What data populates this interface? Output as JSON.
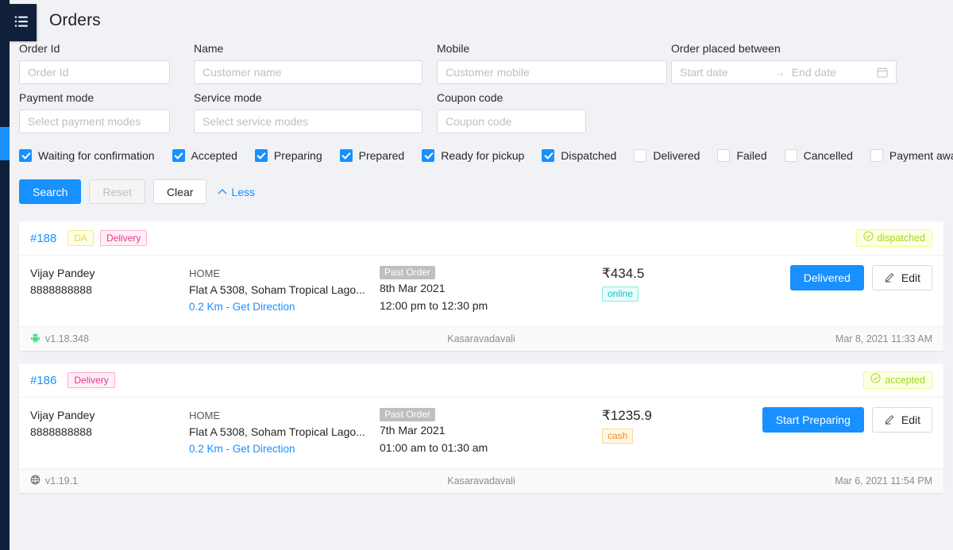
{
  "app": {
    "menu_icon": "hamburger-list-icon",
    "title": "Orders",
    "accent_color": "#1890ff",
    "rail_color": "#10203a"
  },
  "filters": {
    "order_id": {
      "label": "Order Id",
      "placeholder": "Order Id",
      "value": ""
    },
    "name": {
      "label": "Name",
      "placeholder": "Customer name",
      "value": ""
    },
    "mobile": {
      "label": "Mobile",
      "placeholder": "Customer mobile",
      "value": ""
    },
    "date_range": {
      "label": "Order placed between",
      "start_placeholder": "Start date",
      "end_placeholder": "End date",
      "separator": "→",
      "icon": "calendar-icon"
    },
    "payment_mode": {
      "label": "Payment mode",
      "placeholder": "Select payment modes",
      "value": ""
    },
    "service_mode": {
      "label": "Service mode",
      "placeholder": "Select service modes",
      "value": ""
    },
    "coupon_code": {
      "label": "Coupon code",
      "placeholder": "Coupon code",
      "value": ""
    }
  },
  "status_checkboxes": [
    {
      "label": "Waiting for confirmation",
      "checked": true
    },
    {
      "label": "Accepted",
      "checked": true
    },
    {
      "label": "Preparing",
      "checked": true
    },
    {
      "label": "Prepared",
      "checked": true
    },
    {
      "label": "Ready for pickup",
      "checked": true
    },
    {
      "label": "Dispatched",
      "checked": true
    },
    {
      "label": "Delivered",
      "checked": false
    },
    {
      "label": "Failed",
      "checked": false
    },
    {
      "label": "Cancelled",
      "checked": false
    },
    {
      "label": "Payment awaited",
      "checked": false
    }
  ],
  "actions": {
    "search": "Search",
    "reset": "Reset",
    "clear": "Clear",
    "less": "Less",
    "less_icon": "chevron-up-icon"
  },
  "orders": [
    {
      "number": "#188",
      "tags": [
        {
          "text": "DA",
          "type": "da"
        },
        {
          "text": "Delivery",
          "type": "delivery"
        }
      ],
      "status": {
        "text": "dispatched",
        "icon": "check-circle-icon"
      },
      "customer": {
        "name": "Vijay Pandey",
        "phone": "8888888888"
      },
      "address": {
        "type": "HOME",
        "line": "Flat A 5308, Soham Tropical Lago...",
        "distance_link": "0.2 Km - Get Direction"
      },
      "timing": {
        "past_tag": "Past Order",
        "date": "8th Mar 2021",
        "slot": "12:00 pm to 12:30 pm"
      },
      "amount": "₹434.5",
      "payment": {
        "text": "online",
        "type": "online"
      },
      "primary_action": "Delivered",
      "edit_action": "Edit",
      "edit_icon": "pencil-icon",
      "footer": {
        "platform_icon": "android-icon",
        "version": "v1.18.348",
        "location": "Kasaravadavali",
        "timestamp": "Mar 8, 2021 11:33 AM"
      }
    },
    {
      "number": "#186",
      "tags": [
        {
          "text": "Delivery",
          "type": "delivery"
        }
      ],
      "status": {
        "text": "accepted",
        "icon": "check-circle-icon"
      },
      "customer": {
        "name": "Vijay Pandey",
        "phone": "8888888888"
      },
      "address": {
        "type": "HOME",
        "line": "Flat A 5308, Soham Tropical Lago...",
        "distance_link": "0.2 Km - Get Direction"
      },
      "timing": {
        "past_tag": "Past Order",
        "date": "7th Mar 2021",
        "slot": "01:00 am to 01:30 am"
      },
      "amount": "₹1235.9",
      "payment": {
        "text": "cash",
        "type": "cash"
      },
      "primary_action": "Start Preparing",
      "edit_action": "Edit",
      "edit_icon": "pencil-icon",
      "footer": {
        "platform_icon": "globe-icon",
        "version": "v1.19.1",
        "location": "Kasaravadavali",
        "timestamp": "Mar 6, 2021 11:54 PM"
      }
    }
  ]
}
